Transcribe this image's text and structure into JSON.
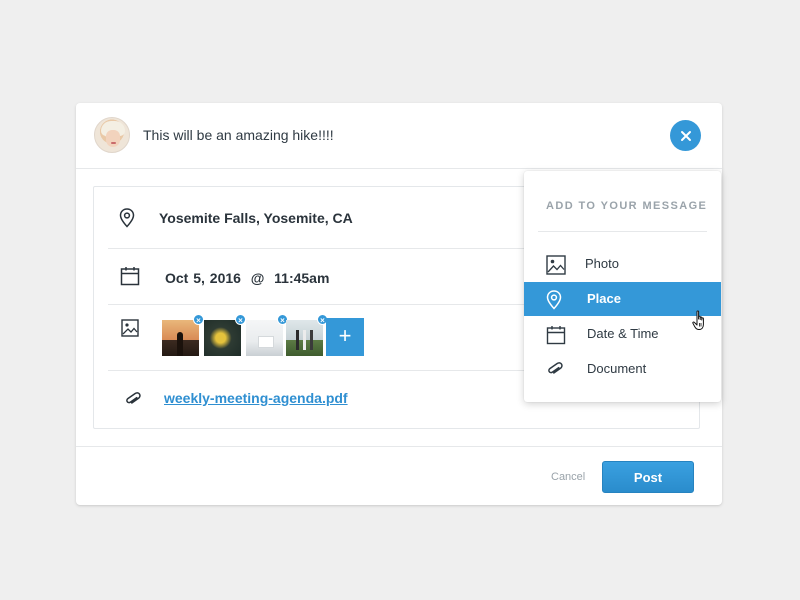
{
  "header": {
    "message": "This will be an amazing hike!!!!",
    "avatar_icon": "user-avatar",
    "close_icon": "close-icon"
  },
  "rows": {
    "location": {
      "icon": "map-pin-icon",
      "text": "Yosemite Falls, Yosemite, CA"
    },
    "date": {
      "icon": "calendar-icon",
      "text": "Oct 5, 2016  @  11:45am"
    },
    "photos": {
      "icon": "image-icon",
      "remove_label": "×",
      "add_label": "+"
    },
    "document": {
      "icon": "paperclip-icon",
      "link_text": "weekly-meeting-agenda.pdf"
    }
  },
  "footer": {
    "cancel_label": "Cancel",
    "post_label": "Post"
  },
  "menu": {
    "title": "ADD TO YOUR MESSAGE",
    "items": [
      {
        "label": "Photo",
        "icon": "image-icon"
      },
      {
        "label": "Place",
        "icon": "map-pin-icon",
        "active": true
      },
      {
        "label": "Date & Time",
        "icon": "calendar-icon"
      },
      {
        "label": "Document",
        "icon": "paperclip-icon"
      }
    ]
  },
  "colors": {
    "accent": "#3498d8",
    "link": "#2f8fd1",
    "background": "#efefef"
  }
}
